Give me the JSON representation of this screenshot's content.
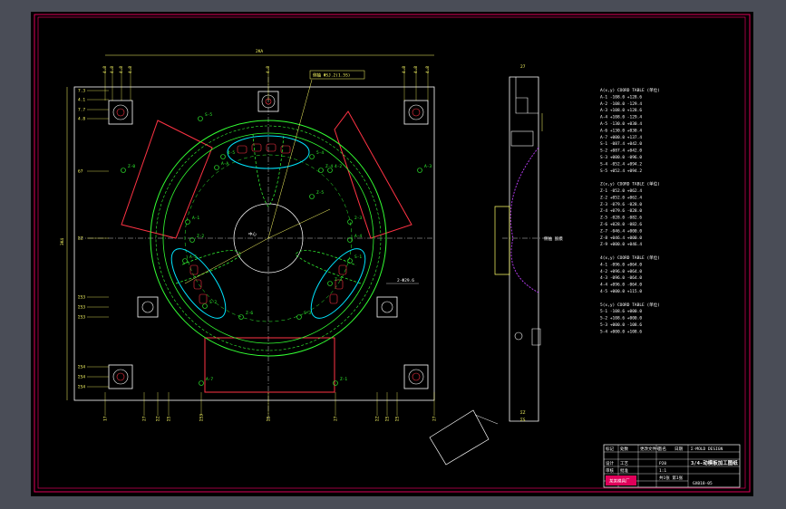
{
  "colors": {
    "frame": "#e0005a",
    "part": "#33ff33",
    "cavity": "#00e5ff",
    "wedge": "#ff3344",
    "dimension": "#ffff66",
    "text": "#ffffff",
    "profile": "#c040ff"
  },
  "dimensions": {
    "overall_width": "2KA",
    "overall_height": "3K4",
    "top_ticks": [
      "4.8",
      "4.8",
      "4.8",
      "4.8",
      "4.8",
      "4.8",
      "4.8",
      "4.8"
    ],
    "left_ticks": [
      "7.3",
      "4.1",
      "7.7",
      "4.8",
      "67",
      "ΣZ",
      "ΣS3",
      "ΣS3",
      "ΣS3",
      "ΣS4",
      "ΣS4",
      "ΣS4"
    ],
    "bottom_ticks": [
      "17",
      "27",
      "ΣZ",
      "ΣS",
      "ΣS3",
      "ΣS",
      "27",
      "ΣZ",
      "ΣS",
      "ΣS",
      "27"
    ],
    "side_ticks": [
      "27",
      "ΣZ",
      "ΣS"
    ]
  },
  "callouts": {
    "top_note": "侧抽 ΦSJ.2(1.5S)",
    "right_note": "2-Φ29.6",
    "center_mark": "中心",
    "side_note": "侧抽 脱模"
  },
  "hole_labels": [
    "Z-0",
    "A-A",
    "S-5",
    "Z-4",
    "4-5",
    "5-4",
    "A-1",
    "2-3",
    "Z-2",
    "A-4",
    "Z-6",
    "S-3",
    "A-7",
    "Z-1",
    "A-3",
    "Z-5",
    "4-2",
    "S-1",
    "A-5",
    "Z-3",
    "S-2"
  ],
  "tech_requirements": [
    "A(x,y) COORD TABLE (单位)",
    "A-1  -108.0   +128.6",
    "A-2  -108.0   -129.4",
    "A-3  +108.0   +128.6",
    "A-4  +108.0   -129.4",
    "A-5  -130.0   +030.4",
    "A-6  +130.0   +030.4",
    "A-7  +000.0   +137.4",
    "S-1  -087.4   +042.0",
    "S-2  +087.4   +042.0",
    "S-3  +000.0   -096.0",
    "S-4  -052.4   +094.2",
    "S-5  +052.4   +094.2",
    "",
    "Z(x,y) COORD TABLE (单位)",
    "Z-1  -052.0   +062.4",
    "Z-2  +052.0   +062.4",
    "Z-3  -079.6   -028.0",
    "Z-4  +079.6   -028.0",
    "Z-5  -028.0   -082.6",
    "Z-6  +028.0   -082.6",
    "Z-7  -046.4   +000.0",
    "Z-8  +046.4   +000.0",
    "Z-9  +000.0   +046.4",
    "",
    "4(x,y) COORD TABLE (单位)",
    "4-1  -096.0   +064.0",
    "4-2  +096.0   +064.0",
    "4-3  -096.0   -064.0",
    "4-4  +096.0   -064.0",
    "4-5  +000.0   +115.0",
    "",
    "5(x,y) COORD TABLE (单位)",
    "5-1  -108.6   +000.0",
    "5-2  +108.6   +000.0",
    "5-3  +000.0   -108.6",
    "5-4  +000.0   +108.6"
  ],
  "title_block": {
    "title": "3/4-动模板加工图纸",
    "drawing_no": "GX018-05",
    "company": "Σ-MOLD DESIGN",
    "row_labels": [
      "标记",
      "处数",
      "更改文件号",
      "签名",
      "日期",
      "设计",
      "审核",
      "工艺",
      "批准"
    ],
    "material": "P20",
    "scale": "1:1",
    "sheet": "共1张 第1张",
    "logo_text": "某某模具厂"
  }
}
